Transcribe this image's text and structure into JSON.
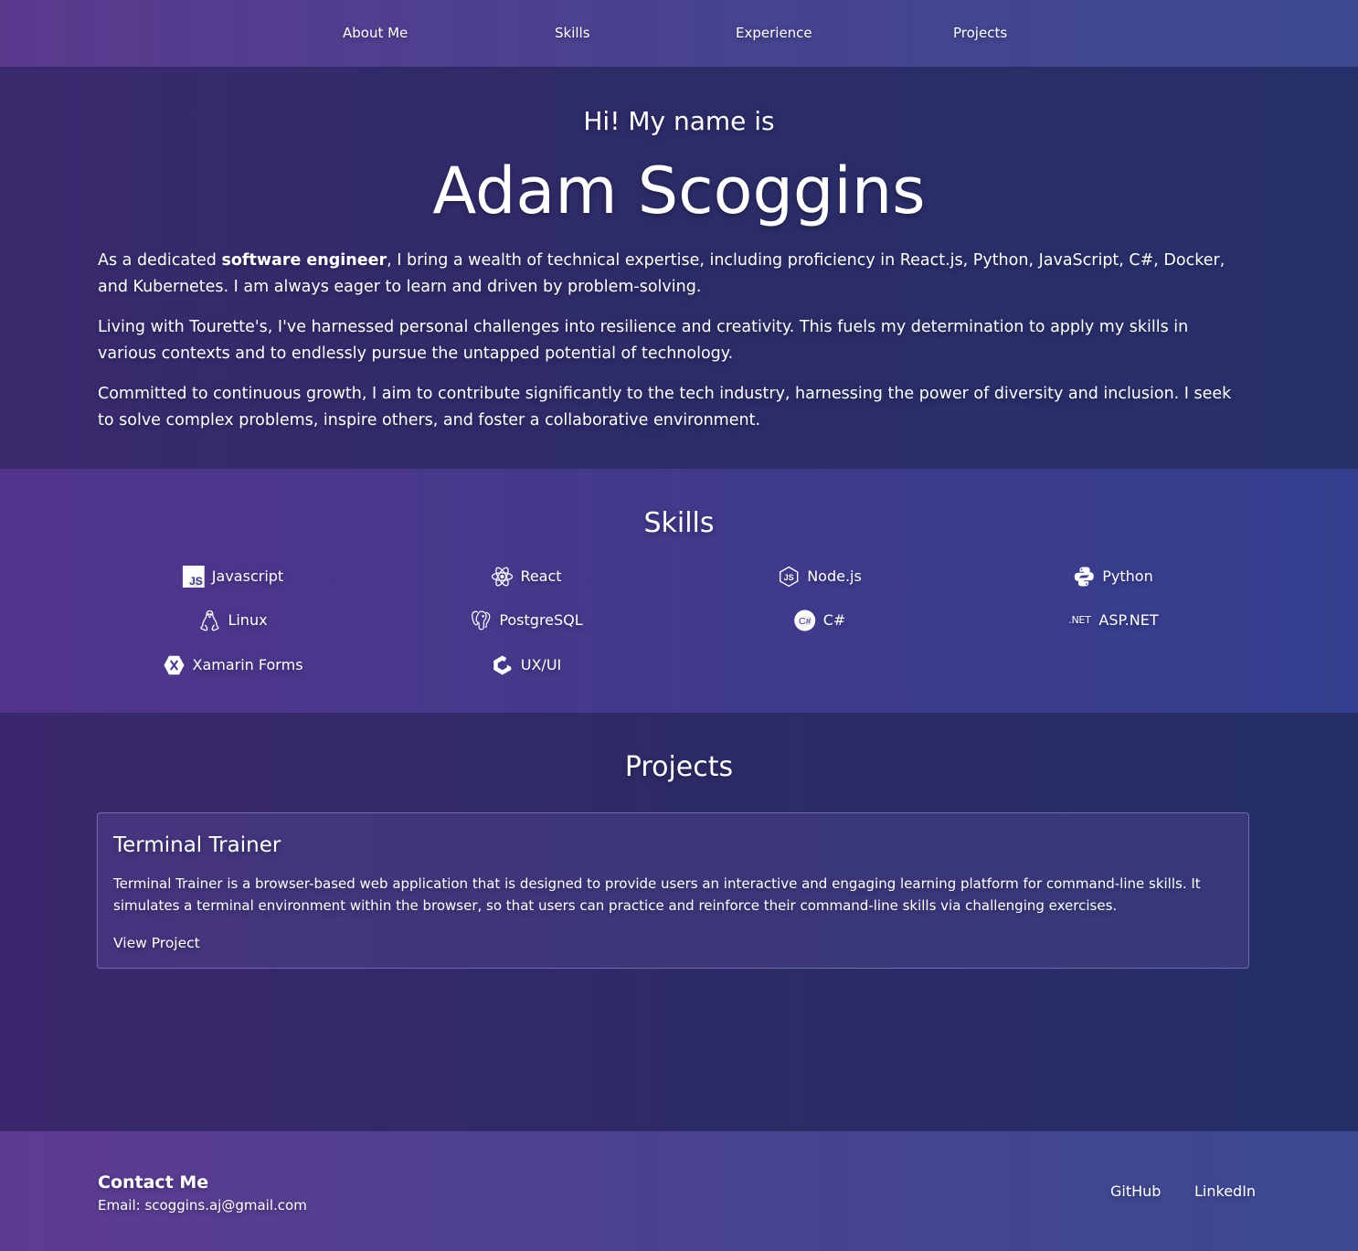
{
  "nav": {
    "items": [
      {
        "label": "About Me"
      },
      {
        "label": "Skills"
      },
      {
        "label": "Experience"
      },
      {
        "label": "Projects"
      }
    ]
  },
  "hero": {
    "greeting": "Hi! My name is",
    "name": "Adam Scoggins",
    "paragraphs": [
      {
        "before": "As a dedicated ",
        "bold": "software engineer",
        "after": ", I bring a wealth of technical expertise, including proficiency in React.js, Python, JavaScript, C#, Docker, and Kubernetes. I am always eager to learn and driven by problem-solving."
      },
      {
        "text": "Living with Tourette's, I've harnessed personal challenges into resilience and creativity. This fuels my determination to apply my skills in various contexts and to endlessly pursue the untapped potential of technology."
      },
      {
        "text": "Committed to continuous growth, I aim to contribute significantly to the tech industry, harnessing the power of diversity and inclusion. I seek to solve complex problems, inspire others, and foster a collaborative environment."
      }
    ]
  },
  "skills": {
    "title": "Skills",
    "items": [
      {
        "label": "Javascript",
        "icon": "javascript-icon"
      },
      {
        "label": "React",
        "icon": "react-icon"
      },
      {
        "label": "Node.js",
        "icon": "nodejs-icon"
      },
      {
        "label": "Python",
        "icon": "python-icon"
      },
      {
        "label": "Linux",
        "icon": "linux-icon"
      },
      {
        "label": "PostgreSQL",
        "icon": "postgresql-icon"
      },
      {
        "label": "C#",
        "icon": "csharp-icon"
      },
      {
        "label": "ASP.NET",
        "icon": "dotnet-icon",
        "icon_text": ".NET"
      },
      {
        "label": "Xamarin Forms",
        "icon": "xamarin-icon"
      },
      {
        "label": "UX/UI",
        "icon": "uxui-icon"
      }
    ]
  },
  "projects": {
    "title": "Projects",
    "items": [
      {
        "title": "Terminal Trainer",
        "description": "Terminal Trainer is a browser-based web application that is designed to provide users an interactive and engaging learning platform for command-line skills. It simulates a terminal environment within the browser, so that users can practice and reinforce their command-line skills via challenging exercises.",
        "link_label": "View Project"
      }
    ]
  },
  "footer": {
    "heading": "Contact Me",
    "email": "Email: scoggins.aj@gmail.com",
    "links": [
      {
        "label": "GitHub"
      },
      {
        "label": "LinkedIn"
      }
    ]
  }
}
